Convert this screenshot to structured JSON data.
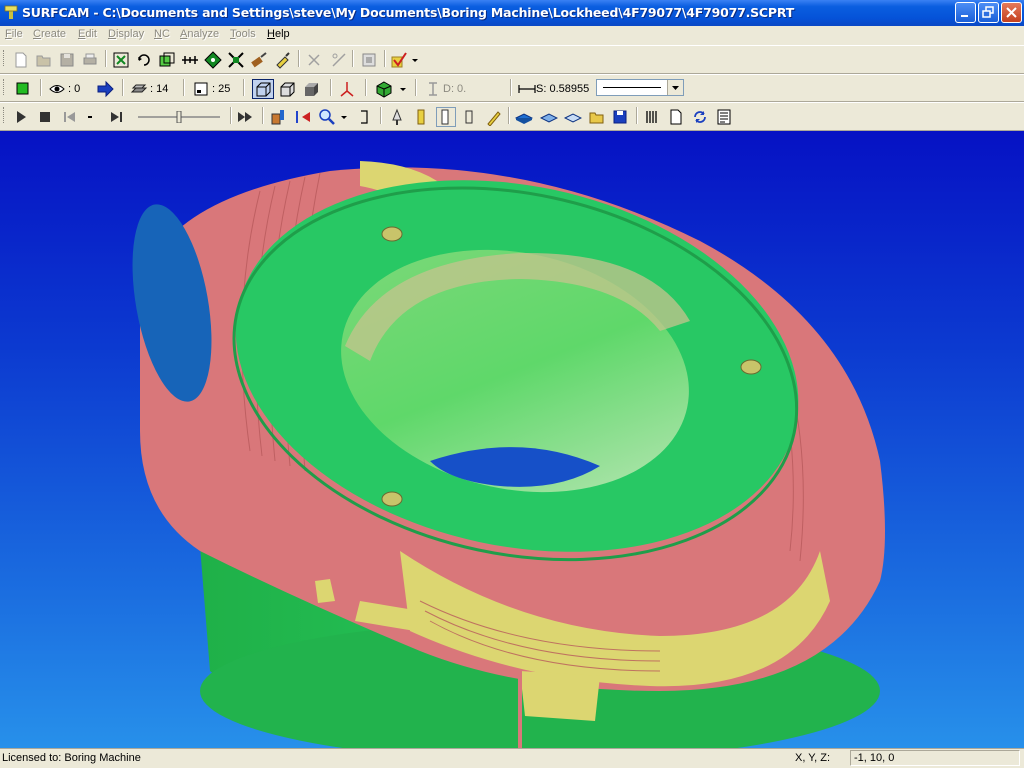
{
  "window": {
    "title": "SURFCAM - C:\\Documents and Settings\\steve\\My Documents\\Boring Machine\\Lockheed\\4F79077\\4F79077.SCPRT"
  },
  "menu": [
    {
      "label": "File",
      "key": "F",
      "rest": "ile",
      "enabled": false
    },
    {
      "label": "Create",
      "key": "C",
      "rest": "reate",
      "enabled": false
    },
    {
      "label": "Edit",
      "key": "E",
      "rest": "dit",
      "enabled": false
    },
    {
      "label": "Display",
      "key": "D",
      "rest": "isplay",
      "enabled": false
    },
    {
      "label": "NC",
      "key": "N",
      "rest": "C",
      "enabled": false
    },
    {
      "label": "Analyze",
      "key": "A",
      "rest": "nalyze",
      "enabled": false
    },
    {
      "label": "Tools",
      "key": "T",
      "rest": "ools",
      "enabled": false
    },
    {
      "label": "Help",
      "key": "H",
      "rest": "elp",
      "enabled": true
    }
  ],
  "toolbar2": {
    "view_count": ": 0",
    "layer_count": ": 14",
    "page_count": ": 25",
    "depth_label": "D: 0.",
    "step_label": "S: 0.58955"
  },
  "status": {
    "licensed": "Licensed to: Boring Machine",
    "coord_label": "X, Y, Z:",
    "coord_value": "-1, 10, 0"
  },
  "colors": {
    "title_blue": "#0552d8",
    "viewport_top": "#0612c4",
    "viewport_bottom": "#2790ea",
    "part_green": "#27c65a",
    "stock_red": "#d9777a",
    "cut_yellow": "#dcd671",
    "face_blue": "#1764b8"
  },
  "icons": {
    "toolbar1": [
      "new-file-icon",
      "open-folder-icon",
      "save-icon",
      "print-icon",
      "zoom-fit-icon",
      "rotate-icon",
      "zoom-window-icon",
      "pan-icon",
      "view-rotate-icon",
      "zoom-extents-icon",
      "paint-brush-icon",
      "delete-icon",
      "trim-icon",
      "layer-icon",
      "check-icon"
    ],
    "toolbar3": [
      "play-icon",
      "stop-icon",
      "rewind-icon",
      "step-forward-icon",
      "fast-forward-icon",
      "simulate-icon",
      "zoom-icon",
      "fit-icon",
      "tool-icon",
      "cutter-icon",
      "holder-icon",
      "highlighter-icon",
      "shaded-stock-icon",
      "stock-icon",
      "wire-stock-icon",
      "open-folder-icon",
      "save-icon",
      "report-icon",
      "page-icon",
      "refresh-icon",
      "list-icon"
    ]
  }
}
